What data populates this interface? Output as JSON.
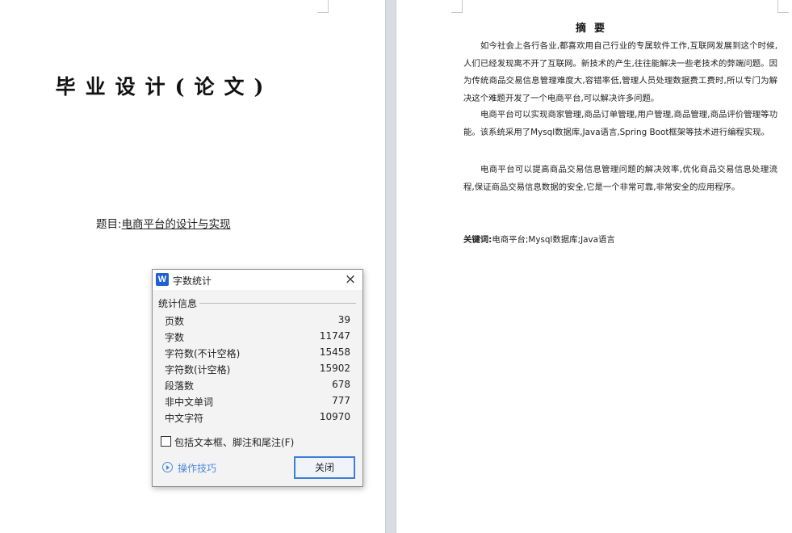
{
  "document": {
    "left_page": {
      "title": "毕业设计(论文)",
      "topic_label": "题目:",
      "topic_value": "电商平台的设计与实现"
    },
    "right_page": {
      "abstract_heading": "摘要",
      "paragraphs": [
        "如今社会上各行各业,都喜欢用自己行业的专属软件工作,互联网发展到这个时候,人们已经发现离不开了互联网。新技术的产生,往往能解决一些老技术的弊端问题。因为传统商品交易信息管理难度大,容错率低,管理人员处理数据费工费时,所以专门为解决这个难题开发了一个电商平台,可以解决许多问题。",
        "电商平台可以实现商家管理,商品订单管理,用户管理,商品管理,商品评价管理等功能。该系统采用了Mysql数据库,Java语言,Spring Boot框架等技术进行编程实现。",
        "电商平台可以提高商品交易信息管理问题的解决效率,优化商品交易信息处理流程,保证商品交易信息数据的安全,它是一个非常可靠,非常安全的应用程序。"
      ],
      "keywords_label": "关键词:",
      "keywords_value": "电商平台;Mysql数据库;Java语言"
    }
  },
  "dialog": {
    "app_icon": "W",
    "title": "字数统计",
    "close_icon": "×",
    "group_label": "统计信息",
    "stats": [
      {
        "label": "页数",
        "value": "39"
      },
      {
        "label": "字数",
        "value": "11747"
      },
      {
        "label": "字符数(不计空格)",
        "value": "15458"
      },
      {
        "label": "字符数(计空格)",
        "value": "15902"
      },
      {
        "label": "段落数",
        "value": "678"
      },
      {
        "label": "非中文单词",
        "value": "777"
      },
      {
        "label": "中文字符",
        "value": "10970"
      }
    ],
    "include_checkbox_label": "包括文本框、脚注和尾注(F)",
    "include_checked": false,
    "tips_label": "操作技巧",
    "close_button_label": "关闭",
    "accent_color": "#3c7fd8",
    "link_color": "#4a89dc"
  }
}
